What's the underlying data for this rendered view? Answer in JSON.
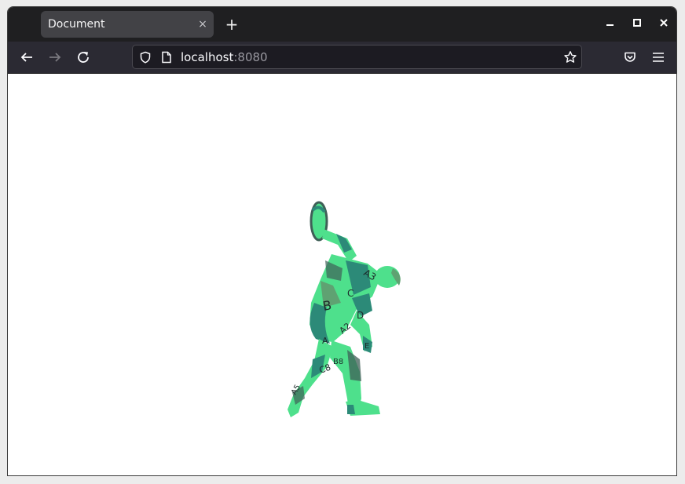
{
  "tab": {
    "title": "Document",
    "close_symbol": "×"
  },
  "tabbar": {
    "new_tab_symbol": "+"
  },
  "window_controls": {
    "minimize": "–",
    "maximize": "□",
    "close": "✕"
  },
  "address_bar": {
    "host": "localhost",
    "port": ":8080"
  },
  "icons": {
    "back": "back-arrow-icon",
    "forward": "forward-arrow-icon",
    "reload": "reload-icon",
    "shield": "tracking-protection-shield-icon",
    "page": "page-icon",
    "bookmark": "bookmark-star-icon",
    "pocket": "pocket-icon",
    "menu": "hamburger-menu-icon"
  },
  "canvas": {
    "description_colors": [
      "#4ee08c",
      "#2c8a78",
      "#5fa272",
      "#3f5f57"
    ],
    "patch_labels": [
      "A3",
      "B",
      "C",
      "A2",
      "A",
      "D",
      "B8",
      "C8",
      "E",
      "A5"
    ]
  }
}
